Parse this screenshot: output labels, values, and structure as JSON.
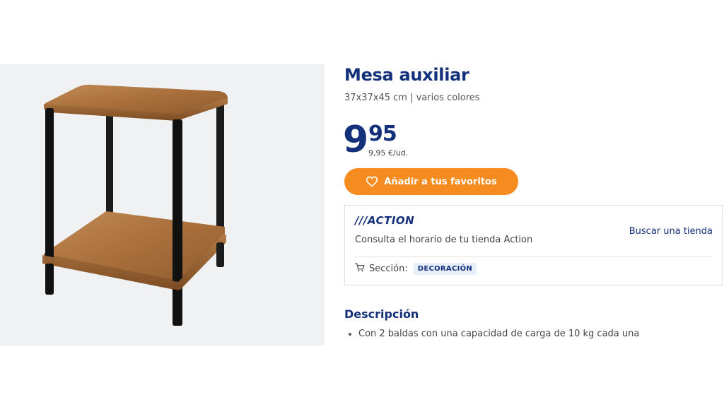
{
  "product": {
    "title": "Mesa auxiliar",
    "subtitle": "37x37x45 cm | varios colores",
    "price_int": "9",
    "price_dec": "95",
    "unit_price": "9,95 €/ud.",
    "image_alt": "product-image"
  },
  "actions": {
    "favorite_label": "Añadir a tus favoritos"
  },
  "store": {
    "logo_text": "///ACTION",
    "hours_note": "Consulta el horario de tu tienda Action",
    "find_store_label": "Buscar una tienda",
    "section_label": "Sección:",
    "section_value": "DECORACIÓN"
  },
  "description": {
    "heading": "Descripción",
    "items": [
      "Con 2 baldas con una capacidad de carga de 10 kg cada una"
    ]
  },
  "colors": {
    "brand_blue": "#13307a",
    "accent_orange": "#f68b1f"
  }
}
